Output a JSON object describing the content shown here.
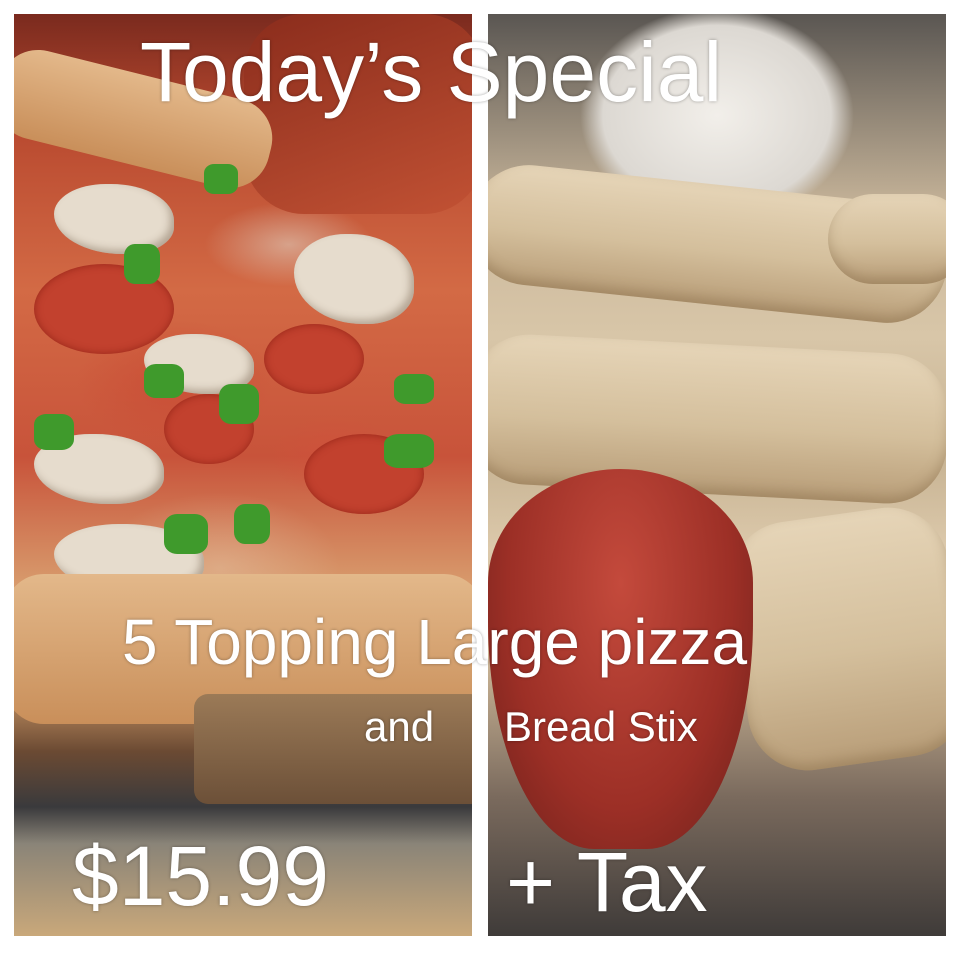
{
  "headline": "Today’s Special",
  "offer_line": "5 Topping Large pizza",
  "conjunction": "and",
  "side_item": "Bread Stix",
  "price": "$15.99",
  "tax_note": "+ Tax",
  "colors": {
    "text": "#ffffff",
    "background": "#ffffff"
  },
  "images": {
    "left": "pizza-photo",
    "right": "breadsticks-with-sauce-photo"
  }
}
